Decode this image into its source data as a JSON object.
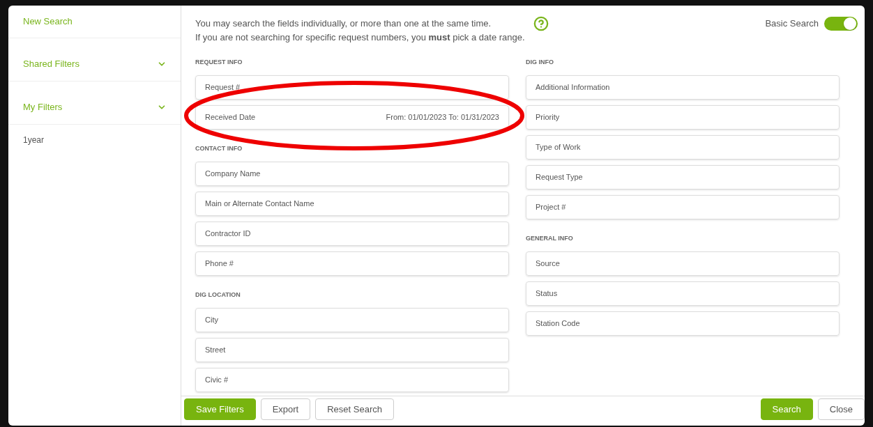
{
  "sidebar": {
    "items": [
      {
        "label": "New Search",
        "expandable": false
      },
      {
        "label": "Shared Filters",
        "expandable": true
      },
      {
        "label": "My Filters",
        "expandable": true,
        "children": [
          {
            "label": "1year"
          }
        ]
      }
    ]
  },
  "intro": [
    "You may search the fields individually, or more than one at the same time.",
    "If you are not searching for specific request numbers, you **must** pick a date range."
  ],
  "basic_search": {
    "label": "Basic Search",
    "on": true
  },
  "columns": [
    [
      {
        "title": "REQUEST INFO",
        "fields": [
          {
            "label": "Request #"
          },
          {
            "label": "Received Date",
            "value": "From: 01/01/2023 To: 01/31/2023"
          }
        ]
      },
      {
        "title": "CONTACT INFO",
        "fields": [
          {
            "label": "Company Name"
          },
          {
            "label": "Main or Alternate Contact Name"
          },
          {
            "label": "Contractor ID"
          },
          {
            "label": "Phone #"
          }
        ]
      },
      {
        "title": "DIG LOCATION",
        "fields": [
          {
            "label": "City"
          },
          {
            "label": "Street"
          },
          {
            "label": "Civic #"
          }
        ]
      }
    ],
    [
      {
        "title": "DIG INFO",
        "fields": [
          {
            "label": "Additional Information"
          },
          {
            "label": "Priority"
          },
          {
            "label": "Type of Work"
          },
          {
            "label": "Request Type"
          },
          {
            "label": "Project #"
          }
        ]
      },
      {
        "title": "GENERAL INFO",
        "fields": [
          {
            "label": "Source"
          },
          {
            "label": "Status"
          },
          {
            "label": "Station Code"
          }
        ]
      }
    ]
  ],
  "footer_left": [
    {
      "label": "Save Filters",
      "primary": true
    },
    {
      "label": "Export",
      "primary": false
    },
    {
      "label": "Reset Search",
      "primary": false
    }
  ],
  "footer_right": [
    {
      "label": "Search",
      "primary": true
    },
    {
      "label": "Close",
      "primary": false
    }
  ]
}
